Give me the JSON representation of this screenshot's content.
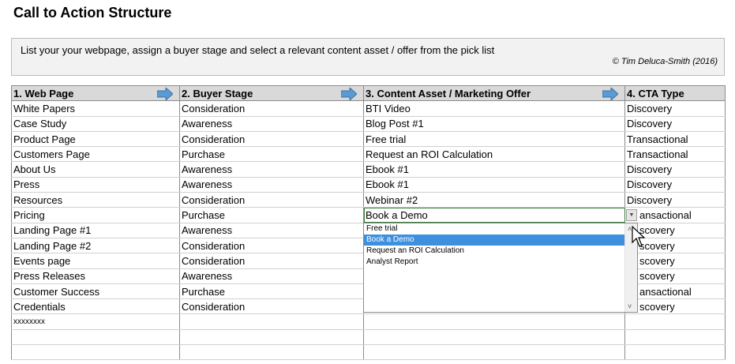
{
  "title": "Call to Action Structure",
  "instructions": {
    "text": "List your your webpage, assign a buyer stage and select a relevant content asset / offer from the pick list",
    "credit": "© Tim Deluca-Smith (2016)"
  },
  "headers": [
    "1. Web Page",
    "2. Buyer Stage",
    "3. Content Asset / Marketing Offer",
    "4. CTA Type"
  ],
  "rows": [
    [
      "White Papers",
      "Consideration",
      "BTI Video",
      "Discovery"
    ],
    [
      "Case Study",
      "Awareness",
      "Blog Post #1",
      "Discovery"
    ],
    [
      "Product Page",
      "Consideration",
      "Free trial",
      "Transactional"
    ],
    [
      "Customers Page",
      "Purchase",
      "Request an ROI Calculation",
      "Transactional"
    ],
    [
      "About Us",
      "Awareness",
      "Ebook #1",
      "Discovery"
    ],
    [
      "Press",
      "Awareness",
      "Ebook #1",
      "Discovery"
    ],
    [
      "Resources",
      "Consideration",
      "Webinar #2",
      "Discovery"
    ],
    [
      "Pricing",
      "Purchase",
      "Book a Demo",
      "ansactional"
    ],
    [
      "Landing Page #1",
      "Awareness",
      "",
      "scovery"
    ],
    [
      "Landing Page #2",
      "Consideration",
      "",
      "scovery"
    ],
    [
      "Events page",
      "Consideration",
      "",
      "scovery"
    ],
    [
      "Press Releases",
      "Awareness",
      "",
      "scovery"
    ],
    [
      "Customer Success",
      "Purchase",
      "",
      "ansactional"
    ],
    [
      "Credentials",
      "Consideration",
      "",
      "scovery"
    ],
    [
      "xxxxxxxx",
      "",
      "",
      ""
    ],
    [
      "",
      "",
      "",
      ""
    ],
    [
      "",
      "",
      "",
      ""
    ],
    [
      "",
      "",
      "",
      ""
    ]
  ],
  "dropdown": {
    "options": [
      "Free trial",
      "Book a Demo",
      "Request an ROI Calculation",
      "Analyst Report"
    ],
    "selected_index": 1
  },
  "colors": {
    "header_bg": "#d9d9d9",
    "arrow": "#5b9bd5",
    "selection": "#3f8fdf"
  },
  "icons": {
    "header_arrow": "arrow-right-icon",
    "dropdown_button": "chevron-down-icon",
    "cursor": "mouse-pointer-icon"
  }
}
